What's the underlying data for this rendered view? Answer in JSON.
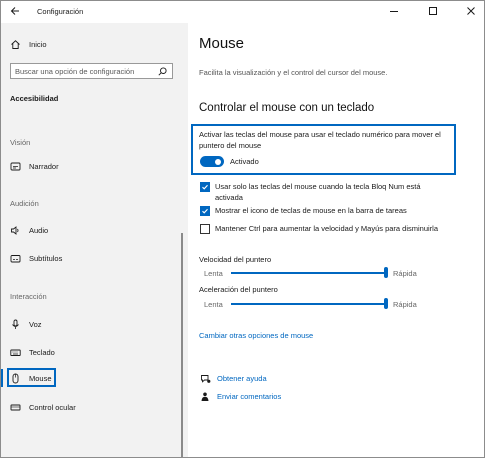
{
  "window": {
    "title": "Configuración"
  },
  "sidebar": {
    "home_label": "Inicio",
    "search_placeholder": "Buscar una opción de configuración",
    "section_title": "Accesibilidad",
    "groups": [
      {
        "label": "Visión"
      },
      {
        "label": "Audición"
      },
      {
        "label": "Interacción"
      }
    ],
    "items": [
      {
        "label": "Narrador",
        "icon": "narrator-icon"
      },
      {
        "label": "Audio",
        "icon": "speaker-icon"
      },
      {
        "label": "Subtítulos",
        "icon": "captions-icon"
      },
      {
        "label": "Voz",
        "icon": "microphone-icon"
      },
      {
        "label": "Teclado",
        "icon": "keyboard-icon"
      },
      {
        "label": "Mouse",
        "icon": "mouse-icon",
        "selected": true
      },
      {
        "label": "Control ocular",
        "icon": "eye-icon"
      }
    ]
  },
  "main": {
    "title": "Mouse",
    "description": "Facilita la visualización y el control del cursor del mouse.",
    "section_heading": "Controlar el mouse con un teclado",
    "toggle": {
      "description": "Activar las teclas del mouse para usar el teclado numérico para mover el puntero del mouse",
      "state_label": "Activado",
      "on": true
    },
    "checkboxes": [
      {
        "label": "Usar solo las teclas del mouse cuando la tecla Bloq Num está activada",
        "checked": true
      },
      {
        "label": "Mostrar el icono de teclas de mouse en la barra de tareas",
        "checked": true
      },
      {
        "label": "Mantener Ctrl para aumentar la velocidad y Mayús para disminuirla",
        "checked": false
      }
    ],
    "sliders": [
      {
        "label": "Velocidad del puntero",
        "min_label": "Lenta",
        "max_label": "Rápida",
        "value": 1.0
      },
      {
        "label": "Aceleración del puntero",
        "min_label": "Lenta",
        "max_label": "Rápida",
        "value": 1.0
      }
    ],
    "more_options_link": "Cambiar otras opciones de mouse",
    "help_links": [
      {
        "label": "Obtener ayuda",
        "icon": "help-chat-icon"
      },
      {
        "label": "Enviar comentarios",
        "icon": "feedback-icon"
      }
    ]
  },
  "colors": {
    "accent": "#0067c0",
    "sidebar_bg": "#f2f2f2"
  }
}
